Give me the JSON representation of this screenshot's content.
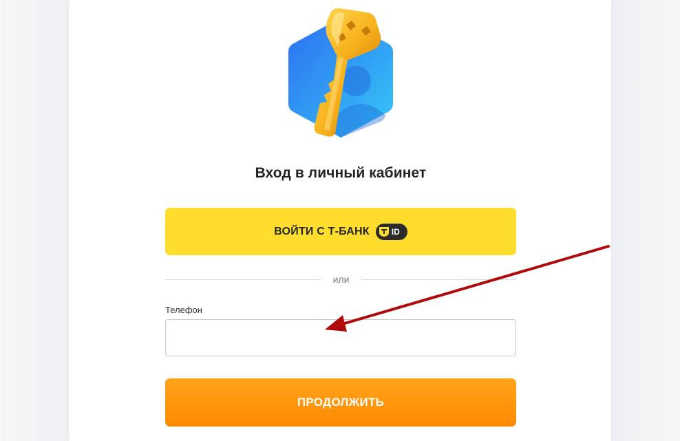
{
  "login": {
    "title": "Вход в личный кабинет",
    "tbank_button_label": "ВОЙТИ С Т-БАНК",
    "tbank_badge_text": "ID",
    "divider_text": "или",
    "phone_label": "Телефон",
    "phone_value": "",
    "continue_label": "ПРОДОЛЖИТЬ"
  },
  "icons": {
    "hero": "key-hexagon-icon",
    "tbank_shield": "tbank-shield-icon",
    "annotation_arrow": "red-arrow-annotation"
  },
  "colors": {
    "tbank_yellow": "#ffdd2d",
    "continue_orange": "#ff8a00",
    "hex_blue": "#2a8cf5",
    "key_gold": "#f5b320",
    "arrow_red": "#b00a0a"
  }
}
